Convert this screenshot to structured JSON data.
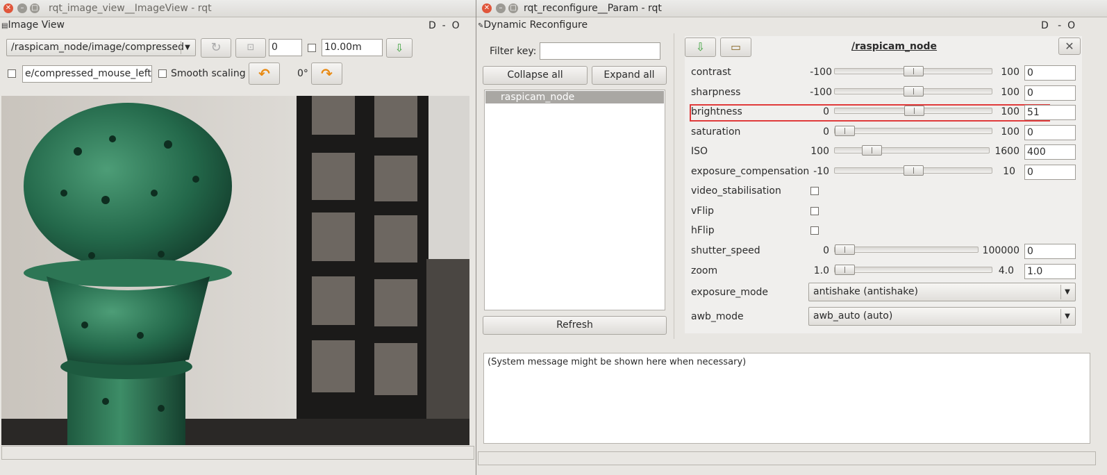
{
  "left_window": {
    "title": "rqt_image_view__ImageView - rqt",
    "panel_title": "Image View",
    "panel_controls": "D  -  O",
    "topic": "/raspicam_node/image/compressed",
    "spin_value": "0",
    "zoom_value": "10.00m",
    "mouse_topic": "e/compressed_mouse_left",
    "smooth_label": "Smooth scaling",
    "rotation": "0°"
  },
  "right_window": {
    "title": "rqt_reconfigure__Param - rqt",
    "panel_title": "Dynamic Reconfigure",
    "panel_controls": "D   -  O",
    "filter_label": "Filter key:",
    "filter_value": "",
    "collapse_label": "Collapse all",
    "expand_label": "Expand all",
    "tree_item": "raspicam_node",
    "refresh_label": "Refresh",
    "node_title": "/raspicam_node",
    "system_message": "(System message might be shown here when necessary)",
    "params": {
      "contrast": {
        "name": "contrast",
        "min": "-100",
        "max": "100",
        "value": "0",
        "level": 0.5
      },
      "sharpness": {
        "name": "sharpness",
        "min": "-100",
        "max": "100",
        "value": "0",
        "level": 0.5
      },
      "brightness": {
        "name": "brightness",
        "min": "0",
        "max": "100",
        "value": "51",
        "level": 0.51
      },
      "saturation": {
        "name": "saturation",
        "min": "0",
        "max": "100",
        "value": "0",
        "level": 0.0
      },
      "iso": {
        "name": "ISO",
        "min": "100",
        "max": "1600",
        "value": "400",
        "level": 0.2
      },
      "exposure_compensation": {
        "name": "exposure_compensation",
        "min": "-10",
        "max": "10",
        "value": "0",
        "level": 0.5
      },
      "video_stabilisation": {
        "name": "video_stabilisation"
      },
      "vflip": {
        "name": "vFlip"
      },
      "hflip": {
        "name": "hFlip"
      },
      "shutter_speed": {
        "name": "shutter_speed",
        "min": "0",
        "max": "100000",
        "value": "0",
        "level": 0.0
      },
      "zoom": {
        "name": "zoom",
        "min": "1.0",
        "max": "4.0",
        "value": "1.0",
        "level": 0.0
      },
      "exposure_mode": {
        "name": "exposure_mode",
        "value": "antishake (antishake)"
      },
      "awb_mode": {
        "name": "awb_mode",
        "value": "awb_auto (auto)"
      }
    }
  },
  "colors": {
    "highlight": "#e03a3a",
    "selection": "#a9a7a3",
    "close": "#e0563b"
  },
  "icons": [
    "close-icon",
    "minimize-icon",
    "maximize-icon",
    "refresh-icon",
    "save-icon",
    "load-icon",
    "rotate-left-icon",
    "rotate-right-icon",
    "fit-icon",
    "dropdown-arrow-icon"
  ]
}
